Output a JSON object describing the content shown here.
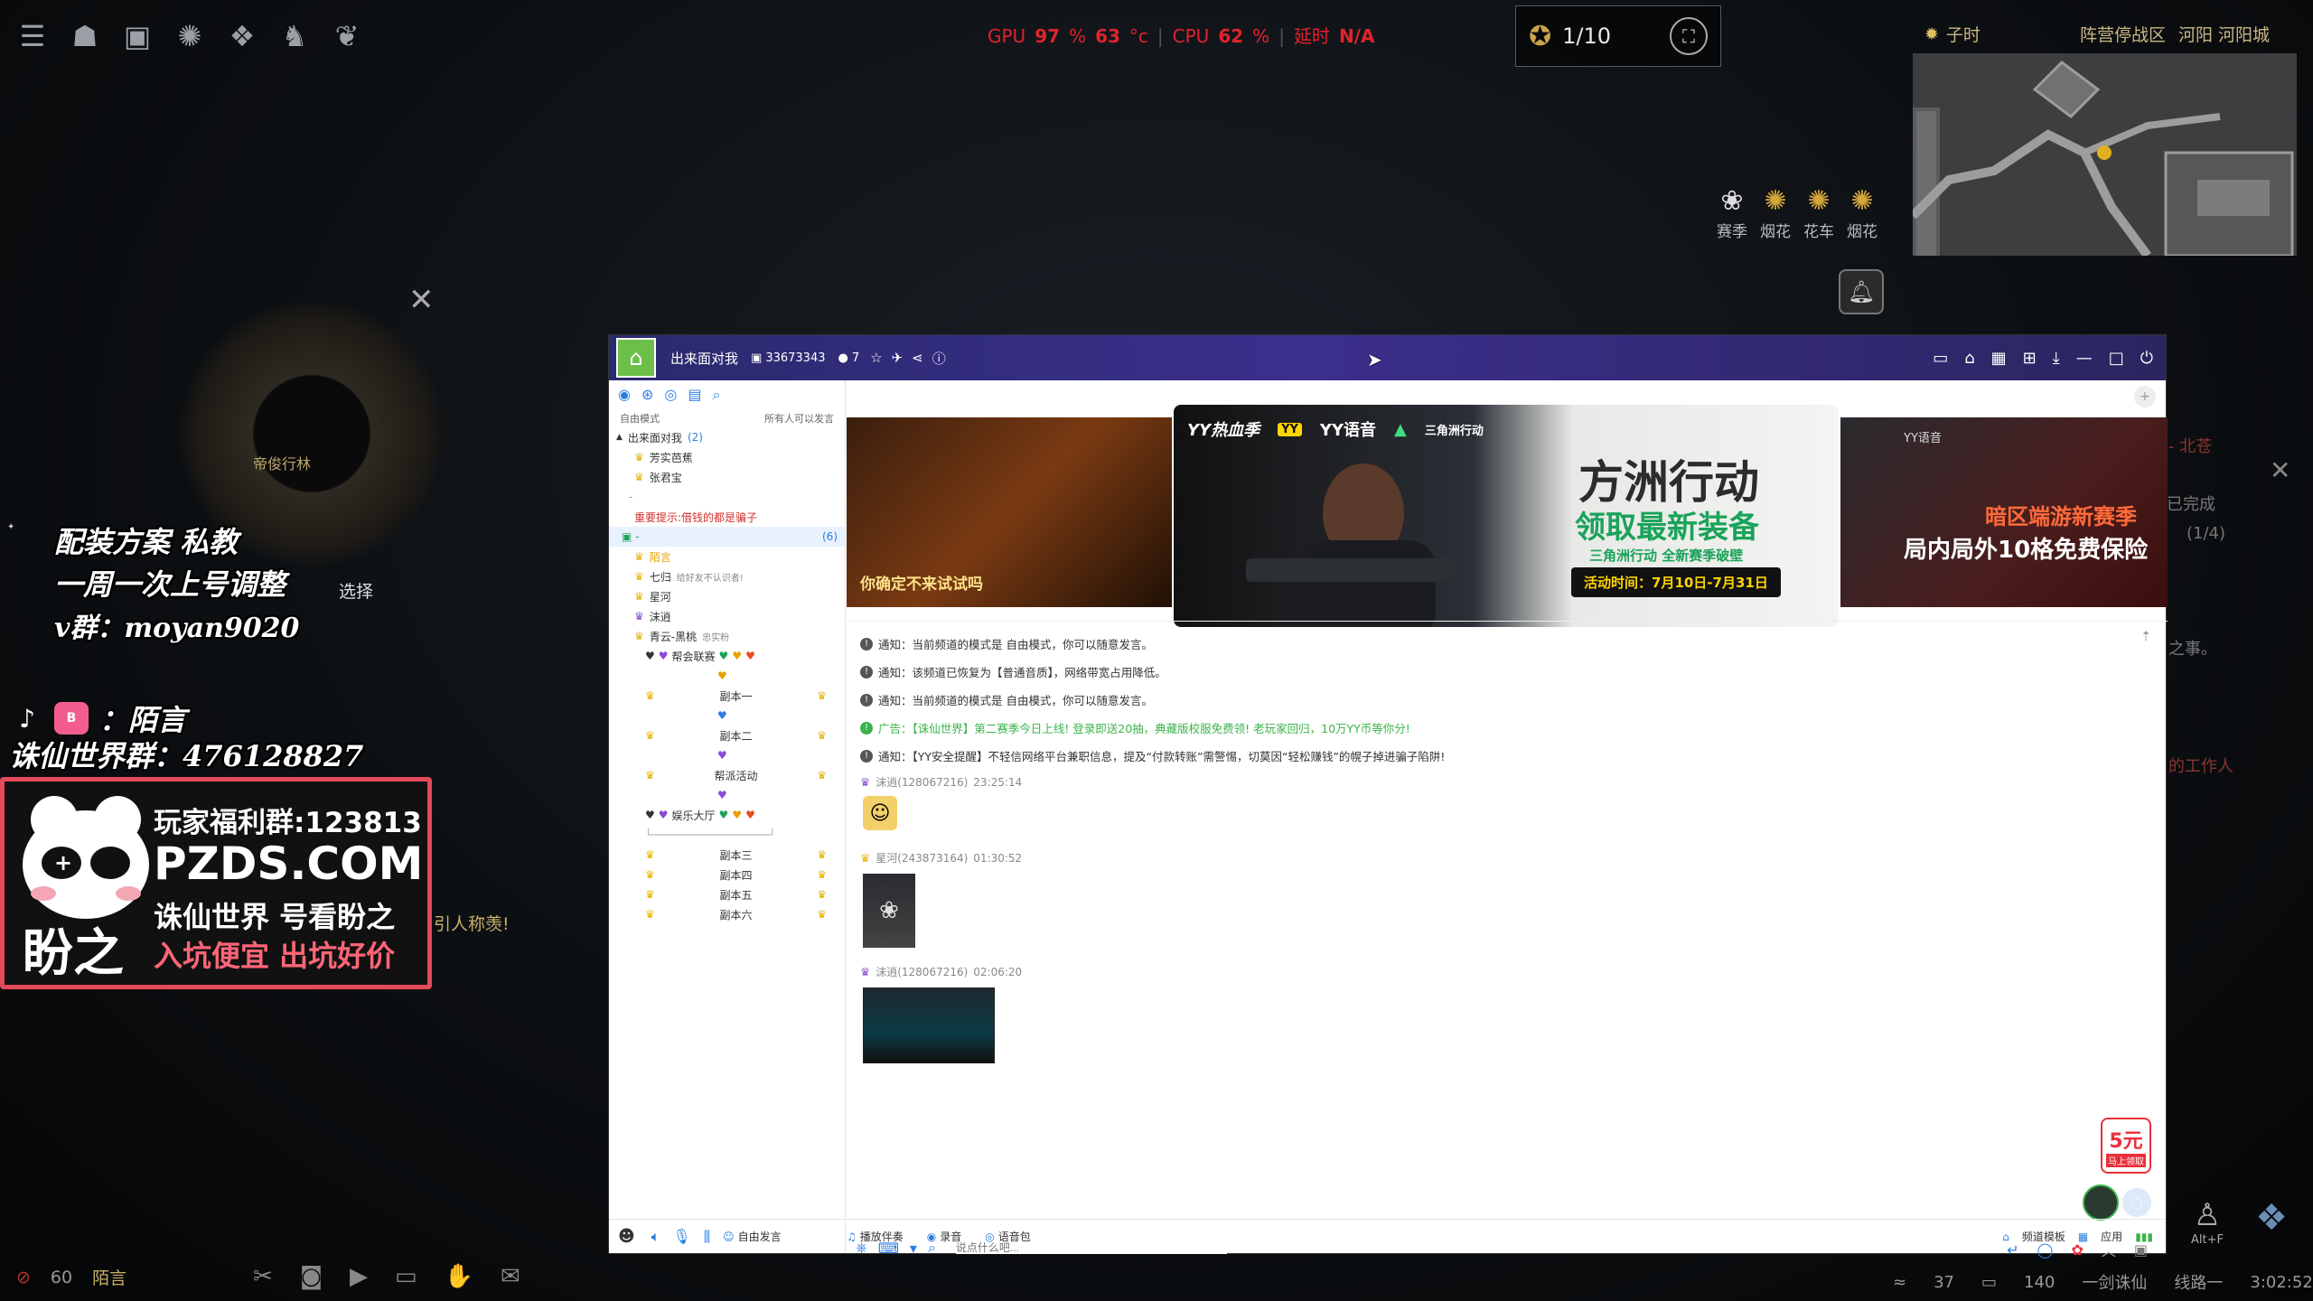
{
  "hud": {
    "gpu_label": "GPU",
    "gpu_value": "97",
    "gpu_unit": "%",
    "gpu_temp": "63",
    "gpu_temp_unit": "°c",
    "cpu_label": "CPU",
    "cpu_value": "62",
    "cpu_unit": "%",
    "latency_label": "延时",
    "latency_value": "N/A",
    "party_count": "1/10",
    "time_label": "子时",
    "zone_label": "阵营停战区",
    "location": "河阳 河阳城",
    "buttons": [
      "赛季",
      "烟花",
      "花车",
      "烟花"
    ],
    "compass_label": "帝俊行林",
    "select_label": "选择",
    "chat_snippet": "引人称羡!",
    "right_snippets": [
      "已完成",
      "(1/4)",
      "之事。",
      "的工作人"
    ],
    "alt_label": "Alt+F",
    "bottom_num": "60",
    "bottom_text": "陌言",
    "ping": "37",
    "fps": "140",
    "server": "一剑诛仙",
    "line": "线路一",
    "clock": "3:02:52"
  },
  "overlay": {
    "ad_line1": "配装方案  私教",
    "ad_line2": "一周一次上号调整",
    "ad_line3": "v群：moyan9020",
    "social_label": "：陌言",
    "group_line": "诛仙世界群：476128827",
    "pz_line1": "玩家福利群:123813",
    "pz_line2": "PZDS.COM",
    "pz_line3": "诛仙世界 号看盼之",
    "pz_line4": "入坑便宜 出坑好价",
    "pz_brand": "盼之"
  },
  "yy": {
    "channel_title": "出来面对我",
    "channel_id": "33673343",
    "online_count": "7",
    "mode_label": "自由模式",
    "speak_all": "所有人可以发言",
    "root_name": "出来面对我",
    "root_count": "(2)",
    "users_top": [
      "芳实芭蕉",
      "张君宝"
    ],
    "warning": "重要提示:借钱的都是骗子",
    "sub_count": "(6)",
    "users_sub": [
      "陌言",
      "七归",
      "星河",
      "沫逍",
      "青云-黑桃"
    ],
    "user_note": "给好友不认识者!",
    "user_note2": "忠实粉",
    "rooms": [
      "帮会联赛",
      "副本一",
      "副本二",
      "帮派活动",
      "娱乐大厅",
      "副本三",
      "副本四",
      "副本五",
      "副本六"
    ],
    "banner_brand": "YY热血季",
    "banner_yy": "YY语音",
    "banner_game": "三角洲行动",
    "banner_title": "方洲行动",
    "banner_sub": "领取最新装备",
    "banner_sub2": "三角洲行动 全新赛季破壁",
    "banner_date": "活动时间：7月10日-7月31日",
    "banner_left_text": "你确定不来试试吗",
    "banner_right_title": "暗区端游新赛季",
    "banner_right_sub": "局内局外10格免费保险",
    "banner_right_brand": "YY语音",
    "notices": [
      "通知：当前频道的模式是 自由模式，你可以随意发言。",
      "通知：该频道已恢复为【普通音质】，网络带宽占用降低。",
      "通知：当前频道的模式是 自由模式，你可以随意发言。"
    ],
    "ad_notice": "广告：【诛仙世界】第二赛季今日上线! 登录即送20抽，典藏版校服免费领! 老玩家回归，10万YY币等你分!",
    "security_notice": "通知：【YY安全提醒】不轻信网络平台兼职信息，提及“付款转账”需警惕，切莫因“轻松赚钱”的幌子掉进骗子陷阱!",
    "messages": [
      {
        "user": "沫逍(128067216)",
        "time": "23:25:14"
      },
      {
        "user": "星河(243873164)",
        "time": "01:30:52"
      },
      {
        "user": "沫逍(128067216)",
        "time": "02:06:20"
      }
    ],
    "input_placeholder": "说点什么吧...",
    "bottom": [
      "自由发言",
      "播放伴奏",
      "录音",
      "语音包"
    ],
    "bottom_right": [
      "频道模板",
      "应用"
    ],
    "promo": "5元",
    "promo_sub": "马上领取"
  },
  "colors": {
    "yy_purple": "#3b2f8c",
    "hud_red": "#e1232e",
    "promo_red": "#e8313a",
    "notice_green": "#3bb34a"
  }
}
